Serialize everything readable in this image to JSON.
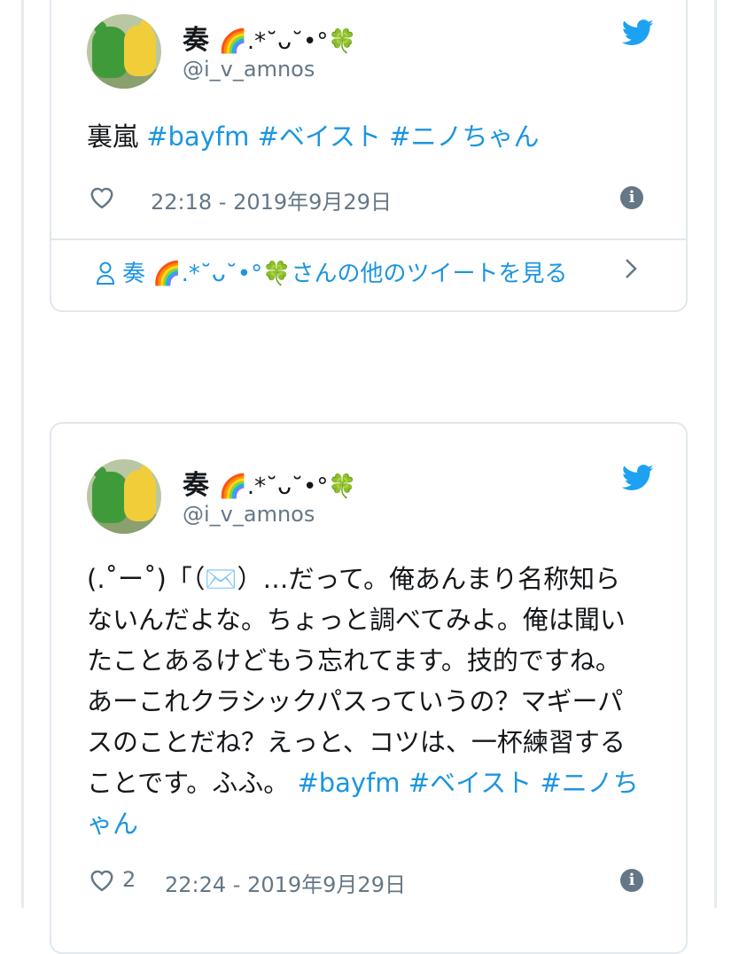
{
  "tweets": [
    {
      "user": {
        "name": "奏",
        "name_deco": "🌈.*˘ᴗ˘•°🍀",
        "handle": "@i_v_amnos"
      },
      "text_parts": [
        {
          "t": "裏嵐 ",
          "tag": false
        },
        {
          "t": "#bayfm",
          "tag": true
        },
        {
          "t": " ",
          "tag": false
        },
        {
          "t": "#ベイスト",
          "tag": true
        },
        {
          "t": " ",
          "tag": false
        },
        {
          "t": "#ニノちゃん",
          "tag": true
        }
      ],
      "time": "22:18 - 2019年9月29日",
      "likes": "",
      "more_link": "奏 🌈.*˘ᴗ˘•°🍀さんの他のツイートを見る"
    },
    {
      "user": {
        "name": "奏",
        "name_deco": "🌈.*˘ᴗ˘•°🍀",
        "handle": "@i_v_amnos"
      },
      "text_parts": [
        {
          "t": "(.˚ー˚)「（✉️）…だって。俺あんまり名称知らないんだよな。ちょっと調べてみよ。俺は聞いたことあるけどもう忘れてます。技的ですね。あーこれクラシックパスっていうの？マギーパスのことだね？えっと、コツは、一杯練習することです。ふふ。 ",
          "tag": false
        },
        {
          "t": "#bayfm",
          "tag": true
        },
        {
          "t": " ",
          "tag": false
        },
        {
          "t": "#ベイスト",
          "tag": true
        },
        {
          "t": " ",
          "tag": false
        },
        {
          "t": "#ニノちゃん",
          "tag": true
        }
      ],
      "time": "22:24 - 2019年9月29日",
      "likes": "2"
    }
  ],
  "colors": {
    "link": "#1b95e0",
    "muted": "#657786",
    "border": "#e1e8ed"
  },
  "icons": [
    "twitter-bird-icon",
    "heart-icon",
    "info-icon",
    "person-icon",
    "chevron-right-icon"
  ]
}
